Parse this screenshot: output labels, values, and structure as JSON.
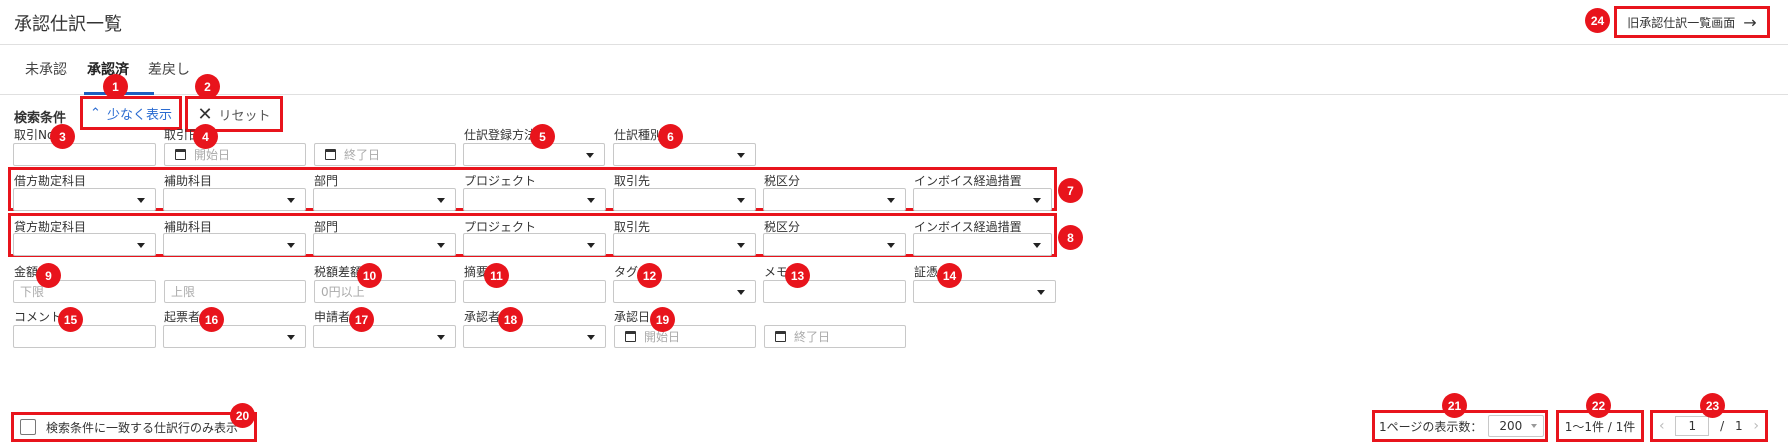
{
  "header": {
    "title": "承認仕訳一覧",
    "old_link_label": "旧承認仕訳一覧画面"
  },
  "tabs": [
    "未承認",
    "承認済",
    "差戻し"
  ],
  "search": {
    "label": "検索条件",
    "less_label": "少なく表示",
    "reset_label": "リセット"
  },
  "row1": {
    "torihiki_no": "取引No",
    "torihiki_date": "取引日",
    "start_ph": "開始日",
    "end_ph": "終了日",
    "method": "仕訳登録方法",
    "kind": "仕訳種別"
  },
  "debit_row": [
    "借方勘定科目",
    "補助科目",
    "部門",
    "プロジェクト",
    "取引先",
    "税区分",
    "インボイス経過措置"
  ],
  "credit_row": [
    "貸方勘定科目",
    "補助科目",
    "部門",
    "プロジェクト",
    "取引先",
    "税区分",
    "インボイス経過措置"
  ],
  "row4": {
    "amount": "金額",
    "amount_min_ph": "下限",
    "amount_max_ph": "上限",
    "tax_diff": "税額差額",
    "tax_diff_ph": "0円以上",
    "summary": "摘要",
    "tag": "タグ",
    "memo": "メモ",
    "evidence": "証憑"
  },
  "row5": {
    "comment": "コメント",
    "drafter": "起票者",
    "applicant": "申請者",
    "approver": "承認者",
    "approve_date": "承認日",
    "start_ph": "開始日",
    "end_ph": "終了日"
  },
  "footer": {
    "match_only_label": "検索条件に一致する仕訳行のみ表示",
    "per_page_label": "1ページの表示数：",
    "per_page_value": "200",
    "range": "1〜1件 / 1件",
    "page_current": "1",
    "page_sep": "/",
    "page_total": "1"
  },
  "badges": [
    "1",
    "2",
    "3",
    "4",
    "5",
    "6",
    "7",
    "8",
    "9",
    "10",
    "11",
    "12",
    "13",
    "14",
    "15",
    "16",
    "17",
    "18",
    "19",
    "20",
    "21",
    "22",
    "23",
    "24"
  ],
  "colors": {
    "annotation_red": "#e8141c",
    "accent_blue": "#2a6bd1"
  }
}
